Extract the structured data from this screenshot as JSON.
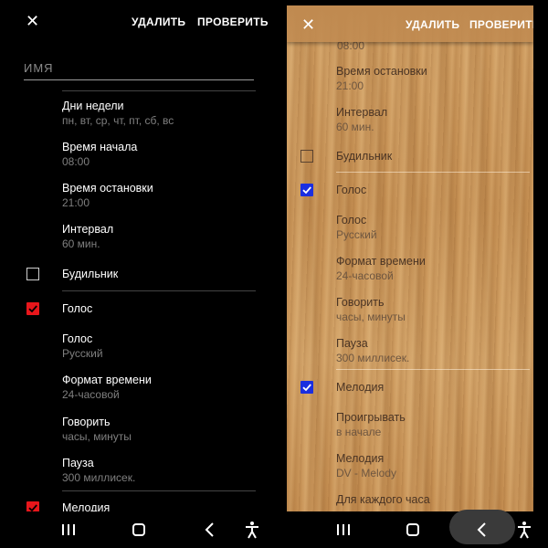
{
  "left": {
    "header": {
      "close": "✕",
      "delete": "УДАЛИТЬ",
      "check": "ПРОВЕРИТЬ"
    },
    "name_placeholder": "ИМЯ",
    "items": [
      {
        "title": "Дни недели",
        "value": "пн, вт, ср, чт, пт, сб, вс"
      },
      {
        "title": "Время начала",
        "value": "08:00"
      },
      {
        "title": "Время остановки",
        "value": "21:00"
      },
      {
        "title": "Интервал",
        "value": "60 мин."
      }
    ],
    "alarm": {
      "label": "Будильник",
      "checked": false
    },
    "voice_toggle": {
      "label": "Голос",
      "checked": true
    },
    "voice_items": [
      {
        "title": "Голос",
        "value": "Русский"
      },
      {
        "title": "Формат времени",
        "value": "24-часовой"
      },
      {
        "title": "Говорить",
        "value": "часы, минуты"
      },
      {
        "title": "Пауза",
        "value": "300 миллисек."
      }
    ],
    "melody_toggle": {
      "label": "Мелодия",
      "checked": true
    },
    "checkbox_color": "#e8161b"
  },
  "right": {
    "header": {
      "close": "✕",
      "delete": "УДАЛИТЬ",
      "check": "ПРОВЕРИТЬ"
    },
    "clipped_value": "08:00",
    "items": [
      {
        "title": "Время остановки",
        "value": "21:00"
      },
      {
        "title": "Интервал",
        "value": "60 мин."
      }
    ],
    "alarm": {
      "label": "Будильник",
      "checked": false
    },
    "voice_toggle": {
      "label": "Голос",
      "checked": true
    },
    "voice_items": [
      {
        "title": "Голос",
        "value": "Русский"
      },
      {
        "title": "Формат времени",
        "value": "24-часовой"
      },
      {
        "title": "Говорить",
        "value": "часы, минуты"
      },
      {
        "title": "Пауза",
        "value": "300 миллисек."
      }
    ],
    "melody_toggle": {
      "label": "Мелодия",
      "checked": true
    },
    "melody_items": [
      {
        "title": "Проигрывать",
        "value": "в начале"
      },
      {
        "title": "Мелодия",
        "value": "DV - Melody"
      },
      {
        "title": "Для каждого часа",
        "value": ""
      }
    ],
    "checkbox_color": "#1a2ee0"
  },
  "navbar": {
    "recents_icon": "recents-icon",
    "home_icon": "home-icon",
    "back_icon": "back-icon",
    "accessibility_icon": "accessibility-icon"
  }
}
